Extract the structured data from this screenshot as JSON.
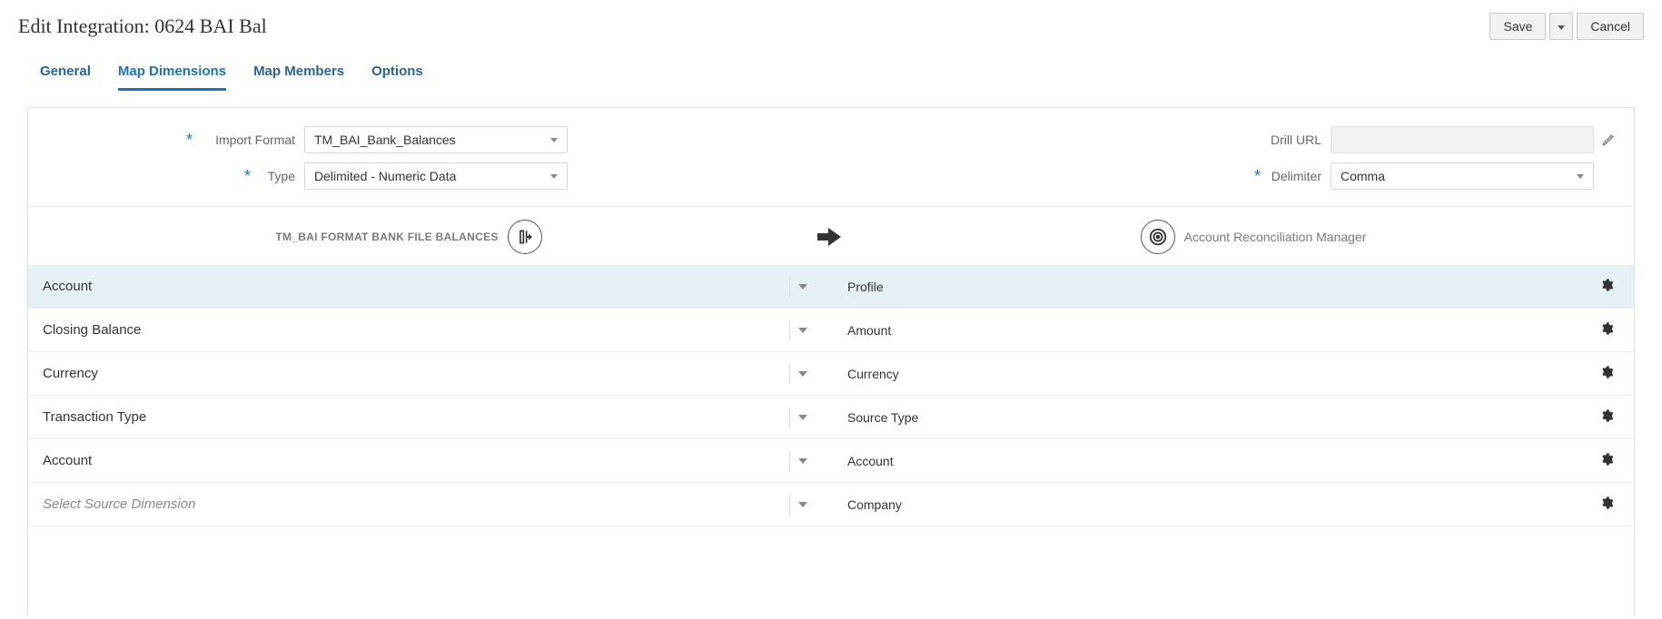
{
  "header": {
    "title": "Edit Integration: 0624 BAI Bal",
    "save_label": "Save",
    "cancel_label": "Cancel"
  },
  "tabs": {
    "general": "General",
    "map_dimensions": "Map Dimensions",
    "map_members": "Map Members",
    "options": "Options",
    "active": "map_dimensions"
  },
  "form": {
    "import_format": {
      "label": "Import Format",
      "value": "TM_BAI_Bank_Balances",
      "required": true
    },
    "type": {
      "label": "Type",
      "value": "Delimited - Numeric Data",
      "required": true
    },
    "drill_url": {
      "label": "Drill URL",
      "value": ""
    },
    "delimiter": {
      "label": "Delimiter",
      "value": "Comma",
      "required": true
    }
  },
  "flow": {
    "source_label": "TM_BAI FORMAT BANK FILE BALANCES",
    "target_label": "Account Reconciliation Manager"
  },
  "map_rows": [
    {
      "source": "Account",
      "target": "Profile",
      "selected": true,
      "placeholder": false
    },
    {
      "source": "Closing Balance",
      "target": "Amount",
      "selected": false,
      "placeholder": false
    },
    {
      "source": "Currency",
      "target": "Currency",
      "selected": false,
      "placeholder": false
    },
    {
      "source": "Transaction Type",
      "target": "Source Type",
      "selected": false,
      "placeholder": false
    },
    {
      "source": "Account",
      "target": "Account",
      "selected": false,
      "placeholder": false
    },
    {
      "source": "Select Source Dimension",
      "target": "Company",
      "selected": false,
      "placeholder": true
    }
  ]
}
